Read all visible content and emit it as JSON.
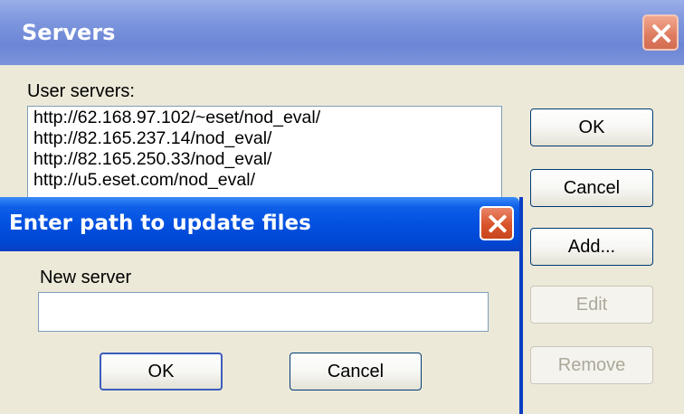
{
  "servers_window": {
    "title": "Servers",
    "user_servers_label": "User servers:",
    "servers": [
      "http://62.168.97.102/~eset/nod_eval/",
      "http://82.165.237.14/nod_eval/",
      "http://82.165.250.33/nod_eval/",
      "http://u5.eset.com/nod_eval/"
    ],
    "buttons": {
      "ok": "OK",
      "cancel": "Cancel",
      "add": "Add...",
      "edit": "Edit",
      "remove": "Remove"
    }
  },
  "path_dialog": {
    "title": "Enter path to update files",
    "new_server_label": "New server",
    "new_server_value": "",
    "buttons": {
      "ok": "OK",
      "cancel": "Cancel"
    }
  }
}
